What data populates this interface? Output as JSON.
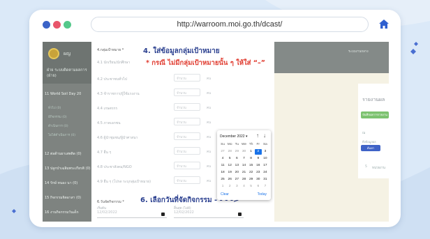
{
  "browser": {
    "url": "http://warroom.moi.go.th/dcast/",
    "dot_colors": [
      "#3b63c7",
      "#e8556b",
      "#55c88a"
    ]
  },
  "sidebar": {
    "brand": "ผญ",
    "user_line1": "ฝ่าย ระบบติดตามผลการ",
    "user_line2": "(ฝ่าย)",
    "items": [
      {
        "label": "11 World Soil Day 20",
        "subs": [
          "ทั่วไป (0)",
          "มีกิจกรรม (0)",
          "ดำเนินการ (0)",
          "ไม่ได้ดำเนินการ (0)"
        ]
      },
      {
        "label": "12 ต่อต้านยาเสพติด (0)"
      },
      {
        "label": "13 ปลูกป่าเฉลิมพระเกียรติ (0)"
      },
      {
        "label": "14 รักษ์ หนอง นา (0)"
      },
      {
        "label": "15 กิจกรรมจิตอาสา (0)"
      },
      {
        "label": "16 งานกิจกรรมวันเด็ก"
      }
    ]
  },
  "form": {
    "section_label": "4.กลุ่มเป้าหมาย *",
    "rows": [
      {
        "label": "4.1 นักเรียน/นักศึกษา",
        "placeholder": "จำนวน",
        "unit": "คน"
      },
      {
        "label": "4.2 ประชาชนทั่วไป",
        "placeholder": "จำนวน",
        "unit": "คน"
      },
      {
        "label": "4.3 ข้าราชการ/ผู้ใช้แรงงาน",
        "placeholder": "จำนวน",
        "unit": "คน"
      },
      {
        "label": "4.4 เกษตรกร",
        "placeholder": "จำนวน",
        "unit": "คน"
      },
      {
        "label": "4.5 ภาคเอกชน",
        "placeholder": "จำนวน",
        "unit": "คน"
      },
      {
        "label": "4.6 ผู้นำชุมชน/ผู้นำศาสนา",
        "placeholder": "จำนวน",
        "unit": "คน"
      },
      {
        "label": "4.7 อื่น ๆ",
        "placeholder": "จำนวน",
        "unit": "คน"
      },
      {
        "label": "4.8 ประชาสังคม/NGO",
        "placeholder": "จำนวน",
        "unit": "คน"
      },
      {
        "label": "4.9 อื่น ๆ (โปรด ระบุกลุ่มเป้าหมาย)",
        "placeholder": "จำนวน",
        "unit": "คน"
      }
    ],
    "date_section_label": "6.วันจัดกิจกรรม *",
    "start_label": "เริ่มต้น",
    "end_label": "สิ้นสุด (ไม่มี)",
    "start_value": "12/02/2022",
    "end_value": "12/02/2022"
  },
  "annotations": {
    "step4": "4. ใส่ข้อมูลกลุ่มเป้าหมาย",
    "note": "* กรณี ไม่มีกลุ่มเป้าหมายนั้น ๆ ให้ใส่ “–”",
    "step6": "6. เลือกวันที่จัดกิจกรรม - - - ->",
    "blue_color": "#2a3f8f",
    "red_color": "#e03a2e"
  },
  "rightpane": {
    "title": "ระบบงานกลาง",
    "header_text": "รายงานผล",
    "green_button": "บันทึกผลการรายงาน",
    "label_a": "ณ",
    "label_b": "ดึงข้อมูลผล",
    "blue_button": "ค้นหา",
    "number": "5",
    "unit": "หน่วยงาน"
  },
  "calendar": {
    "month_label": "December 2022 ▾",
    "prev": "↑",
    "next": "↓",
    "weekdays": [
      "Su",
      "Mo",
      "Tu",
      "We",
      "Th",
      "Fr",
      "Sa"
    ],
    "weeks": [
      [
        "27",
        "28",
        "29",
        "30",
        "1",
        "2",
        "3"
      ],
      [
        "4",
        "5",
        "6",
        "7",
        "8",
        "9",
        "10"
      ],
      [
        "11",
        "12",
        "13",
        "14",
        "15",
        "16",
        "17"
      ],
      [
        "18",
        "19",
        "20",
        "21",
        "22",
        "23",
        "24"
      ],
      [
        "25",
        "26",
        "27",
        "28",
        "29",
        "30",
        "31"
      ],
      [
        "1",
        "2",
        "3",
        "4",
        "5",
        "6",
        "7"
      ]
    ],
    "selected": "2",
    "clear": "Clear",
    "today": "Today",
    "accent": "#1a73e8"
  }
}
